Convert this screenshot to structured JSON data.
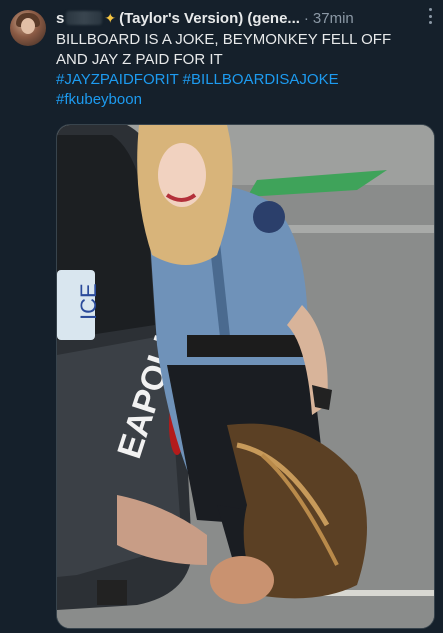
{
  "tweet": {
    "display_name_prefix": "s",
    "display_name_suffix": "(Taylor's Version) (gene...",
    "dot": "·",
    "time": "37min",
    "lines": [
      "BILLBOARD IS A JOKE, BEYMONKEY FELL OFF",
      "AND JAY Z PAID FOR IT"
    ],
    "hashtags_line1": "#JAYZPAIDFORIT #BILLBOARDISAJOKE",
    "hashtags_line2": "#fkubeyboon"
  },
  "media": {
    "vehicle_text": "EAPOLIS",
    "plate_text": "ICE"
  },
  "colors": {
    "background": "#15202b",
    "text": "#e7e9ea",
    "secondary": "#8b98a5",
    "link": "#1d9bf0"
  }
}
